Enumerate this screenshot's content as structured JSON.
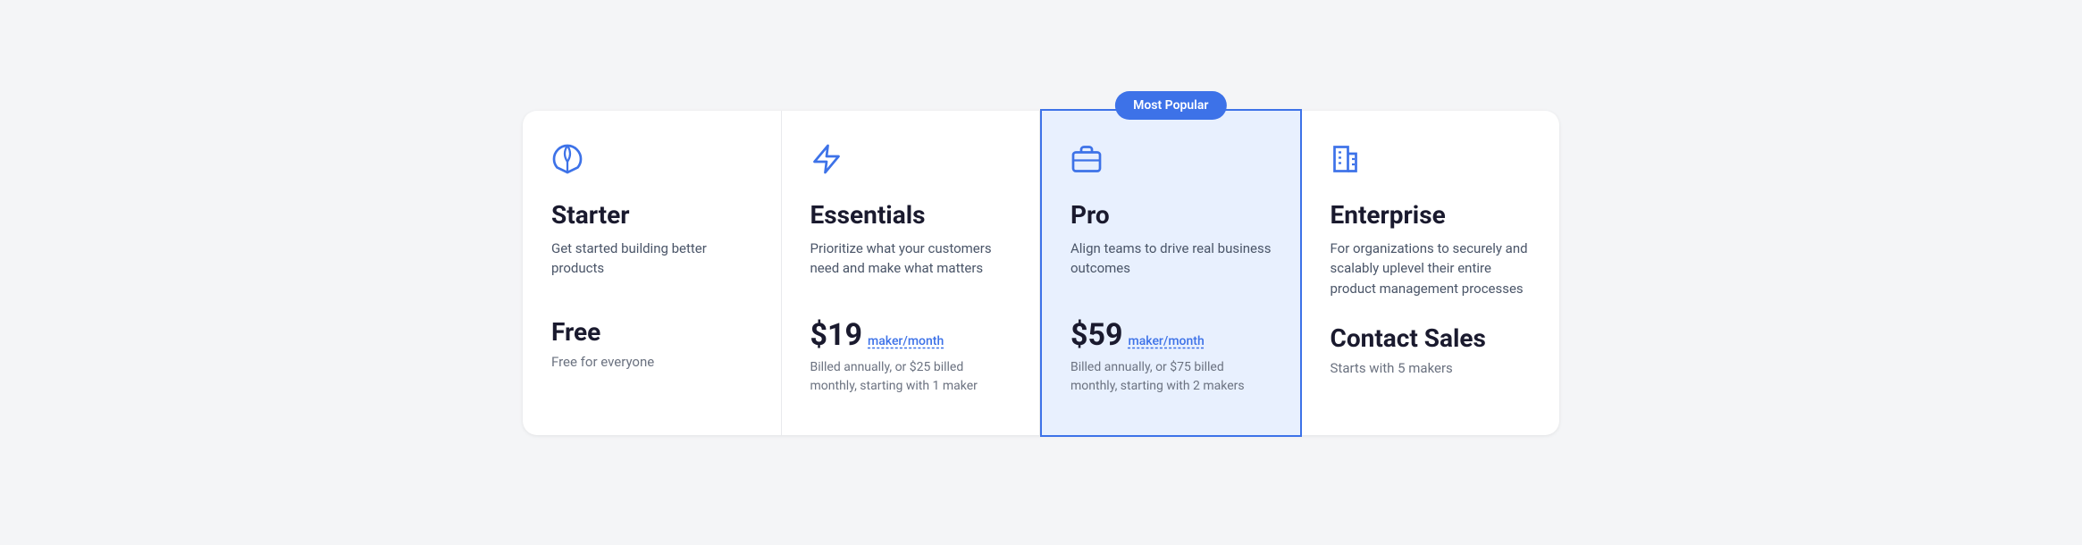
{
  "badge": {
    "most_popular": "Most Popular"
  },
  "plans": [
    {
      "id": "starter",
      "icon": "leaf-icon",
      "name": "Starter",
      "description": "Get started building better products",
      "pricing_type": "free",
      "free_label": "Free",
      "free_note": "Free for everyone",
      "featured": false
    },
    {
      "id": "essentials",
      "icon": "rocket-icon",
      "name": "Essentials",
      "description": "Prioritize what your customers need and make what matters",
      "pricing_type": "paid",
      "price_amount": "$19",
      "price_unit": "maker/month",
      "billing_note": "Billed annually, or $25 billed monthly, starting with 1 maker",
      "featured": false
    },
    {
      "id": "pro",
      "icon": "briefcase-icon",
      "name": "Pro",
      "description": "Align teams to drive real business outcomes",
      "pricing_type": "paid",
      "price_amount": "$59",
      "price_unit": "maker/month",
      "billing_note": "Billed annually, or $75 billed monthly, starting with 2 makers",
      "featured": true
    },
    {
      "id": "enterprise",
      "icon": "building-icon",
      "name": "Enterprise",
      "description": "For organizations to securely and scalably uplevel their entire product management processes",
      "pricing_type": "contact",
      "contact_label": "Contact Sales",
      "contact_note": "Starts with 5 makers",
      "featured": false
    }
  ]
}
